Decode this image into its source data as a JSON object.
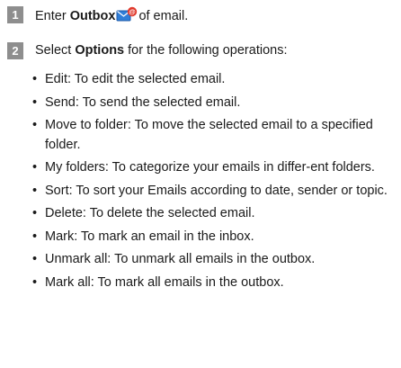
{
  "steps": [
    {
      "number": "1",
      "text_before": "Enter ",
      "bold": "Outbox",
      "icon": "outbox-envelope-icon",
      "text_after": "of email."
    },
    {
      "number": "2",
      "text_before": "Select ",
      "bold": "Options",
      "text_after": " for the following operations:"
    }
  ],
  "bullet_glyph": "•",
  "bullets": [
    "Edit: To edit the selected email.",
    "Send: To send the selected email.",
    "Move to folder: To move the selected email to a specified folder.",
    "My folders: To categorize your emails in differ-ent folders.",
    "Sort: To sort your Emails according to date, sender or topic.",
    "Delete: To delete the selected email.",
    "Mark: To mark an email in the inbox.",
    "Unmark all: To unmark all emails in the outbox.",
    "Mark all: To mark all emails in the outbox."
  ],
  "colors": {
    "badge": "#8e8e8e",
    "icon_red": "#e0382b",
    "icon_blue": "#2f7ed8"
  }
}
